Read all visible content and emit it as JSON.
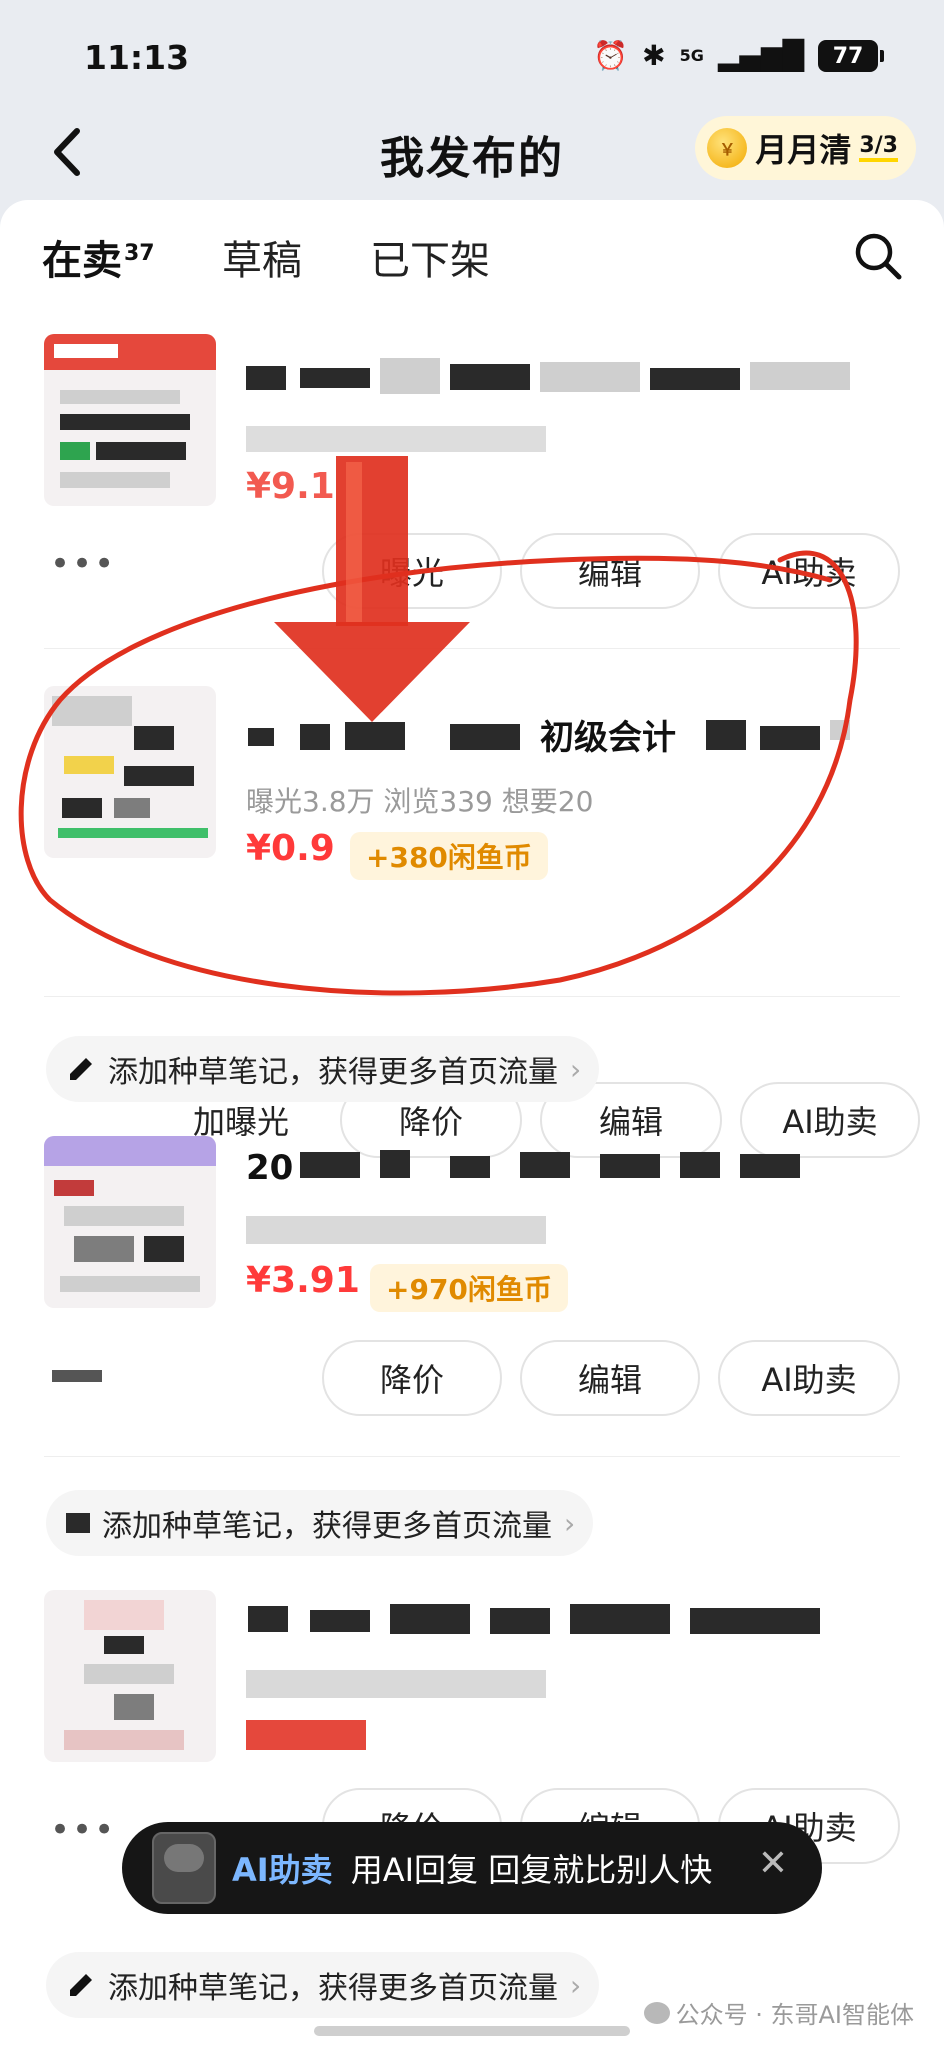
{
  "status": {
    "time": "11:13",
    "battery": "77",
    "net": "5G"
  },
  "nav": {
    "title": "我发布的",
    "monthly_label": "月月清",
    "monthly_count": "3/3"
  },
  "tabs": {
    "selling": "在卖",
    "selling_count": "37",
    "draft": "草稿",
    "off": "已下架"
  },
  "items": [
    {
      "price_partial": "¥9.1",
      "buttons": [
        "曝光",
        "编辑",
        "AI助卖"
      ]
    },
    {
      "title_partial": "初级会计",
      "stats": "曝光3.8万  浏览339  想要20",
      "price": "¥0.9",
      "coins": "+380闲鱼币",
      "buttons": [
        "加曝光",
        "降价",
        "编辑",
        "AI助卖"
      ]
    },
    {
      "tip": "添加种草笔记，获得更多首页流量",
      "title_partial": "20",
      "price": "¥3.91",
      "coins": "+970闲鱼币",
      "buttons": [
        "降价",
        "编辑",
        "AI助卖"
      ]
    },
    {
      "tip": "添加种草笔记，获得更多首页流量",
      "buttons": [
        "降价",
        "编辑",
        "AI助卖"
      ]
    }
  ],
  "bottom_tip": "添加种草笔记，获得更多首页流量",
  "toast": {
    "ai": "AI助卖",
    "message": "用AI回复 回复就比别人快"
  },
  "watermark": "公众号 · 东哥AI智能体",
  "colors": {
    "price_red": "#ff3a3a",
    "coin_orange": "#e08a00",
    "annotation_red": "#e0301e",
    "tab_highlight": "#ffe14d"
  }
}
